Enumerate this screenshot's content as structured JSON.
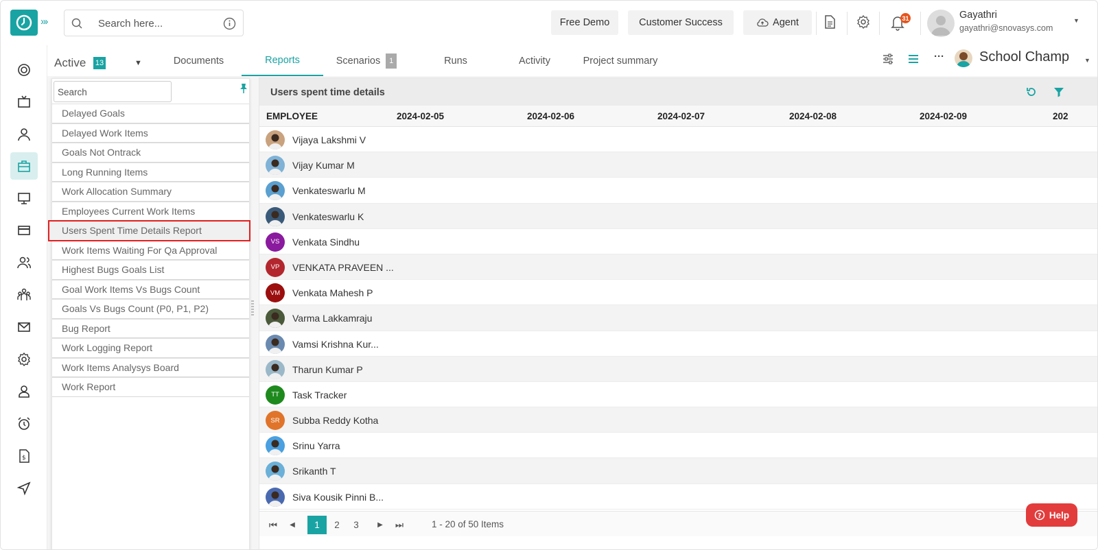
{
  "header": {
    "search_placeholder": "Search here...",
    "buttons": {
      "free_demo": "Free Demo",
      "customer_success": "Customer Success",
      "agent": "Agent"
    },
    "notification_count": "31",
    "user": {
      "name": "Gayathri",
      "email": "gayathri@snovasys.com"
    }
  },
  "subnav": {
    "active_label": "Active",
    "active_count": "13",
    "tabs": [
      {
        "label": "Documents"
      },
      {
        "label": "Reports",
        "selected": true
      },
      {
        "label": "Scenarios",
        "count": "1"
      },
      {
        "label": "Runs"
      },
      {
        "label": "Activity"
      },
      {
        "label": "Project summary"
      }
    ],
    "project_name": "School Champ"
  },
  "report_list": {
    "search_placeholder": "Search",
    "items": [
      "Delayed Goals",
      "Delayed Work Items",
      "Goals Not Ontrack",
      "Long Running Items",
      "Work Allocation Summary",
      "Employees Current Work Items",
      "Users Spent Time Details Report",
      "Work Items Waiting For Qa Approval",
      "Highest Bugs Goals List",
      "Goal Work Items Vs Bugs Count",
      "Goals Vs Bugs Count (P0, P1, P2)",
      "Bug Report",
      "Work Logging Report",
      "Work Items Analysys Board",
      "Work Report"
    ],
    "selected": "Users Spent Time Details Report"
  },
  "report": {
    "title": "Users spent time details",
    "columns": [
      "EMPLOYEE",
      "2024-02-05",
      "2024-02-06",
      "2024-02-07",
      "2024-02-08",
      "2024-02-09",
      "202"
    ],
    "rows": [
      {
        "name": "Vijaya Lakshmi V",
        "initials": "",
        "color": "#c9a27e"
      },
      {
        "name": "Vijay Kumar M",
        "initials": "",
        "color": "#7fb2d6"
      },
      {
        "name": "Venkateswarlu M",
        "initials": "",
        "color": "#5aa0d0"
      },
      {
        "name": "Venkateswarlu K",
        "initials": "",
        "color": "#3a5a7a"
      },
      {
        "name": "Venkata Sindhu",
        "initials": "VS",
        "color": "#8a1a9e"
      },
      {
        "name": "VENKATA PRAVEEN ...",
        "initials": "VP",
        "color": "#b3262e"
      },
      {
        "name": "Venkata Mahesh P",
        "initials": "VM",
        "color": "#9c0f0f"
      },
      {
        "name": "Varma Lakkamraju",
        "initials": "",
        "color": "#4a5a3a"
      },
      {
        "name": "Vamsi Krishna Kur...",
        "initials": "",
        "color": "#6a8ab0"
      },
      {
        "name": "Tharun Kumar P",
        "initials": "",
        "color": "#9ab8c8"
      },
      {
        "name": "Task Tracker",
        "initials": "TT",
        "color": "#1e8a1e"
      },
      {
        "name": "Subba Reddy Kotha",
        "initials": "SR",
        "color": "#e0742a"
      },
      {
        "name": "Srinu Yarra",
        "initials": "",
        "color": "#4aa0e0"
      },
      {
        "name": "Srikanth T",
        "initials": "",
        "color": "#6ab0d8"
      },
      {
        "name": "Siva Kousik Pinni B...",
        "initials": "",
        "color": "#4a6ab0"
      }
    ]
  },
  "pager": {
    "pages": [
      "1",
      "2",
      "3"
    ],
    "current": "1",
    "info": "1 - 20 of 50 Items"
  },
  "help_label": "Help",
  "colors": {
    "accent": "#1aa3a3",
    "highlight": "#e02020",
    "help": "#e23c3c"
  }
}
